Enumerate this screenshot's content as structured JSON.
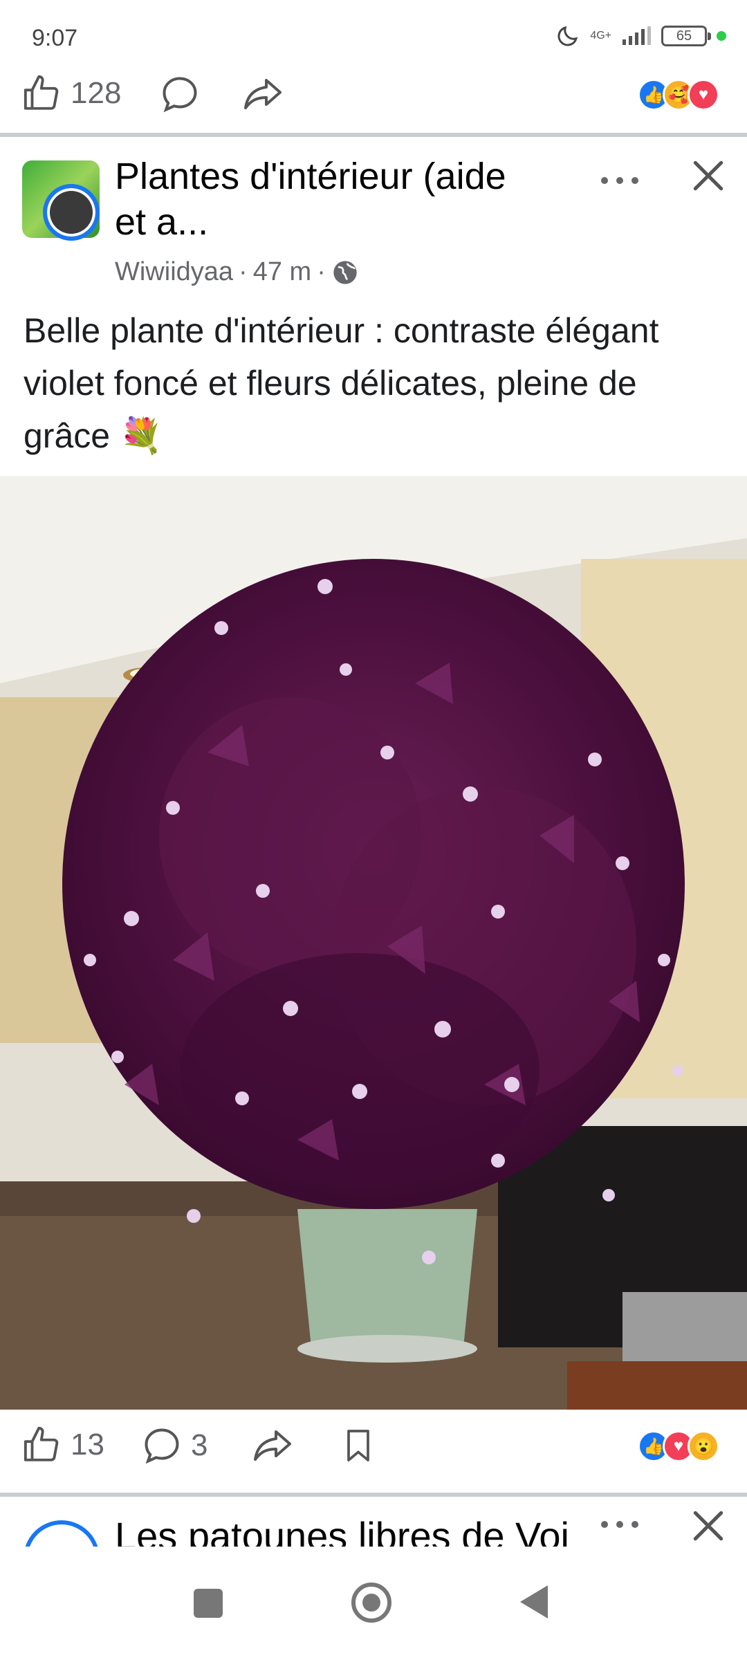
{
  "status": {
    "time": "9:07",
    "network": "4G+",
    "battery": "65"
  },
  "prev_post": {
    "like_count": "128"
  },
  "post": {
    "group_name": "Plantes d'intérieur (aide et a...",
    "author": "Wiwiidyaa",
    "time_ago": "47 m",
    "meta_sep": "·",
    "text": "Belle plante d'intérieur : contraste élégant violet foncé et fleurs délicates, pleine de grâce 💐",
    "like_count": "13",
    "comment_count": "3"
  },
  "next_post": {
    "group_name": "Les patounes libres de Voi"
  },
  "icons": {
    "like": "thumbs-up-icon",
    "comment": "comment-bubble-icon",
    "share": "share-arrow-icon",
    "save": "bookmark-icon",
    "more": "more-dots-icon",
    "close": "close-icon",
    "globe": "globe-icon"
  },
  "colors": {
    "accent": "#1877f2",
    "love": "#f33e58",
    "care": "#f7b125"
  }
}
